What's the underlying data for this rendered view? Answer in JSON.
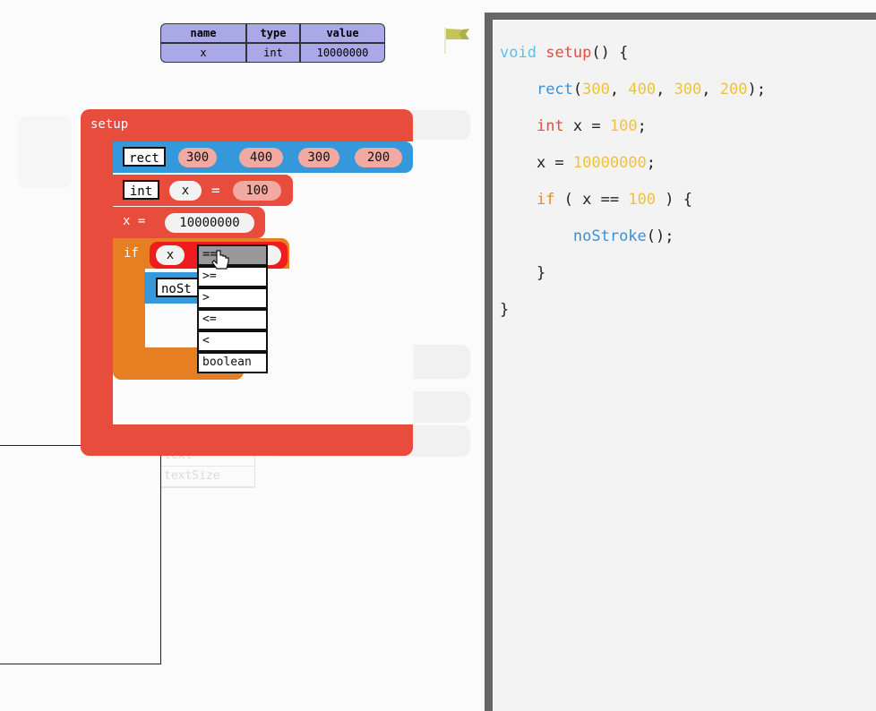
{
  "variables": {
    "headers": [
      "name",
      "type",
      "value"
    ],
    "rows": [
      {
        "name": "x",
        "type": "int",
        "value": "10000000"
      }
    ]
  },
  "blocks": {
    "setup_label": "setup",
    "rect": {
      "keyword": "rect",
      "args": [
        "300",
        "400",
        "300",
        "200"
      ]
    },
    "declare": {
      "type": "int",
      "var": "x",
      "eq": "=",
      "value": "100"
    },
    "assign": {
      "label": "x =",
      "value": "10000000"
    },
    "if_block": {
      "keyword": "if",
      "left": "x",
      "op": "==",
      "right": ""
    },
    "nostroke": {
      "label": "noSt"
    }
  },
  "operator_dropdown": {
    "selected": "==",
    "options": [
      ">=",
      ">",
      "<=",
      "<",
      "boolean"
    ]
  },
  "ghost_items": [
    "text",
    "textSize"
  ],
  "code": {
    "line1": {
      "void": "void",
      "fn": "setup",
      "rest": "() {"
    },
    "line2": {
      "call": "rect",
      "p1": "(",
      "n1": "300",
      "c1": ", ",
      "n2": "400",
      "c2": ", ",
      "n3": "300",
      "c3": ", ",
      "n4": "200",
      "end": ");"
    },
    "line3": {
      "type": "int",
      "mid": " x = ",
      "num": "100",
      "end": ";"
    },
    "line4": {
      "start": "x = ",
      "num": "10000000",
      "end": ";"
    },
    "line5": {
      "kw": "if",
      "mid": " ( x == ",
      "num": "100",
      "end": " ) {"
    },
    "line6": {
      "call": "noStroke",
      "end": "();"
    },
    "line7": "}",
    "line8": "}"
  },
  "colors": {
    "setup_block": "#e84c3d",
    "rect_block": "#3498db",
    "if_block": "#e67e22",
    "arg_pill": "#f2a9a1",
    "variable_table": "#a9a9e8",
    "flag": "#c4c45a"
  },
  "icons": {
    "flag": "flag-icon",
    "cursor": "cursor-pointer-icon"
  }
}
